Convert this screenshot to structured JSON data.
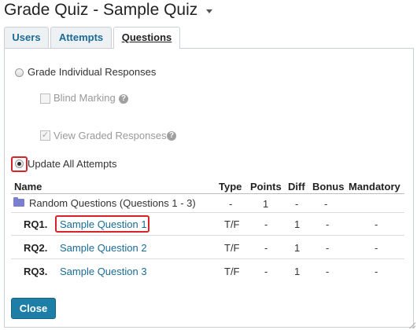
{
  "header": {
    "title": "Grade Quiz - Sample Quiz"
  },
  "tabs": [
    {
      "label": "Users"
    },
    {
      "label": "Attempts"
    },
    {
      "label": "Questions"
    }
  ],
  "options": {
    "grade_individual": "Grade Individual Responses",
    "blind_marking": "Blind Marking",
    "view_graded": "View Graded Responses",
    "update_all": "Update All Attempts",
    "help_glyph": "?",
    "checkmark": "✓"
  },
  "table": {
    "headers": {
      "name": "Name",
      "type": "Type",
      "points": "Points",
      "diff": "Diff",
      "bonus": "Bonus",
      "mandatory": "Mandatory"
    },
    "group": {
      "name": "Random Questions (Questions 1 - 3)",
      "type": "-",
      "points": "1",
      "diff": "-",
      "bonus": "-"
    },
    "rows": [
      {
        "id": "RQ1.",
        "name": "Sample Question 1",
        "type": "T/F",
        "points": "-",
        "diff": "1",
        "bonus": "-",
        "mandatory": "-"
      },
      {
        "id": "RQ2.",
        "name": "Sample Question 2",
        "type": "T/F",
        "points": "-",
        "diff": "1",
        "bonus": "-",
        "mandatory": "-"
      },
      {
        "id": "RQ3.",
        "name": "Sample Question 3",
        "type": "T/F",
        "points": "-",
        "diff": "1",
        "bonus": "-",
        "mandatory": "-"
      }
    ]
  },
  "footer": {
    "close_label": "Close"
  },
  "colors": {
    "link": "#1a6b96",
    "button": "#1d7ea7",
    "highlight": "#d6242a"
  }
}
